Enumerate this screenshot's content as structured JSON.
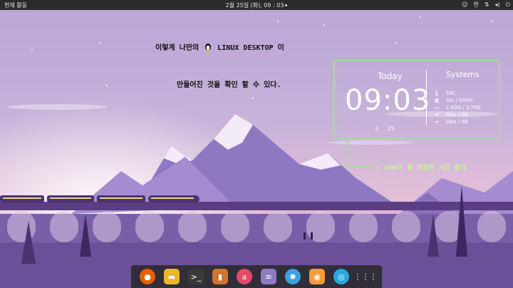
{
  "topbar": {
    "activities": "현재 활동",
    "clock": "2월 25일 (화), 09 : 03",
    "lang": "한",
    "tray_icons": [
      "accessibility-icon",
      "network-icon",
      "volume-icon",
      "power-icon"
    ]
  },
  "annotations": {
    "line1_part1": "이렇게 나만의",
    "line1_part2": "LINUX DESKTOP 이",
    "line2": "만들어진 것을 확인 할 수 있다.",
    "conky_label": "CONKY 를 적용한 시간 출력"
  },
  "conky": {
    "today_label": "Today",
    "time": "09:03",
    "month": "2",
    "day": "25",
    "systems_label": "Systems",
    "stats": [
      "59C",
      "3% / 100%",
      "1.63G / 3.75G",
      "kb/s / 0B",
      "kb/s / 0B"
    ]
  },
  "dock": {
    "apps": [
      "firefox-icon",
      "files-icon",
      "terminal-icon",
      "document-viewer-icon",
      "browser-icon",
      "text-editor-icon",
      "app-icon",
      "camera-icon",
      "help-icon",
      "show-apps-icon"
    ]
  },
  "colors": {
    "accent_green": "#a8d8a0",
    "topbar": "#2b2b2b"
  }
}
